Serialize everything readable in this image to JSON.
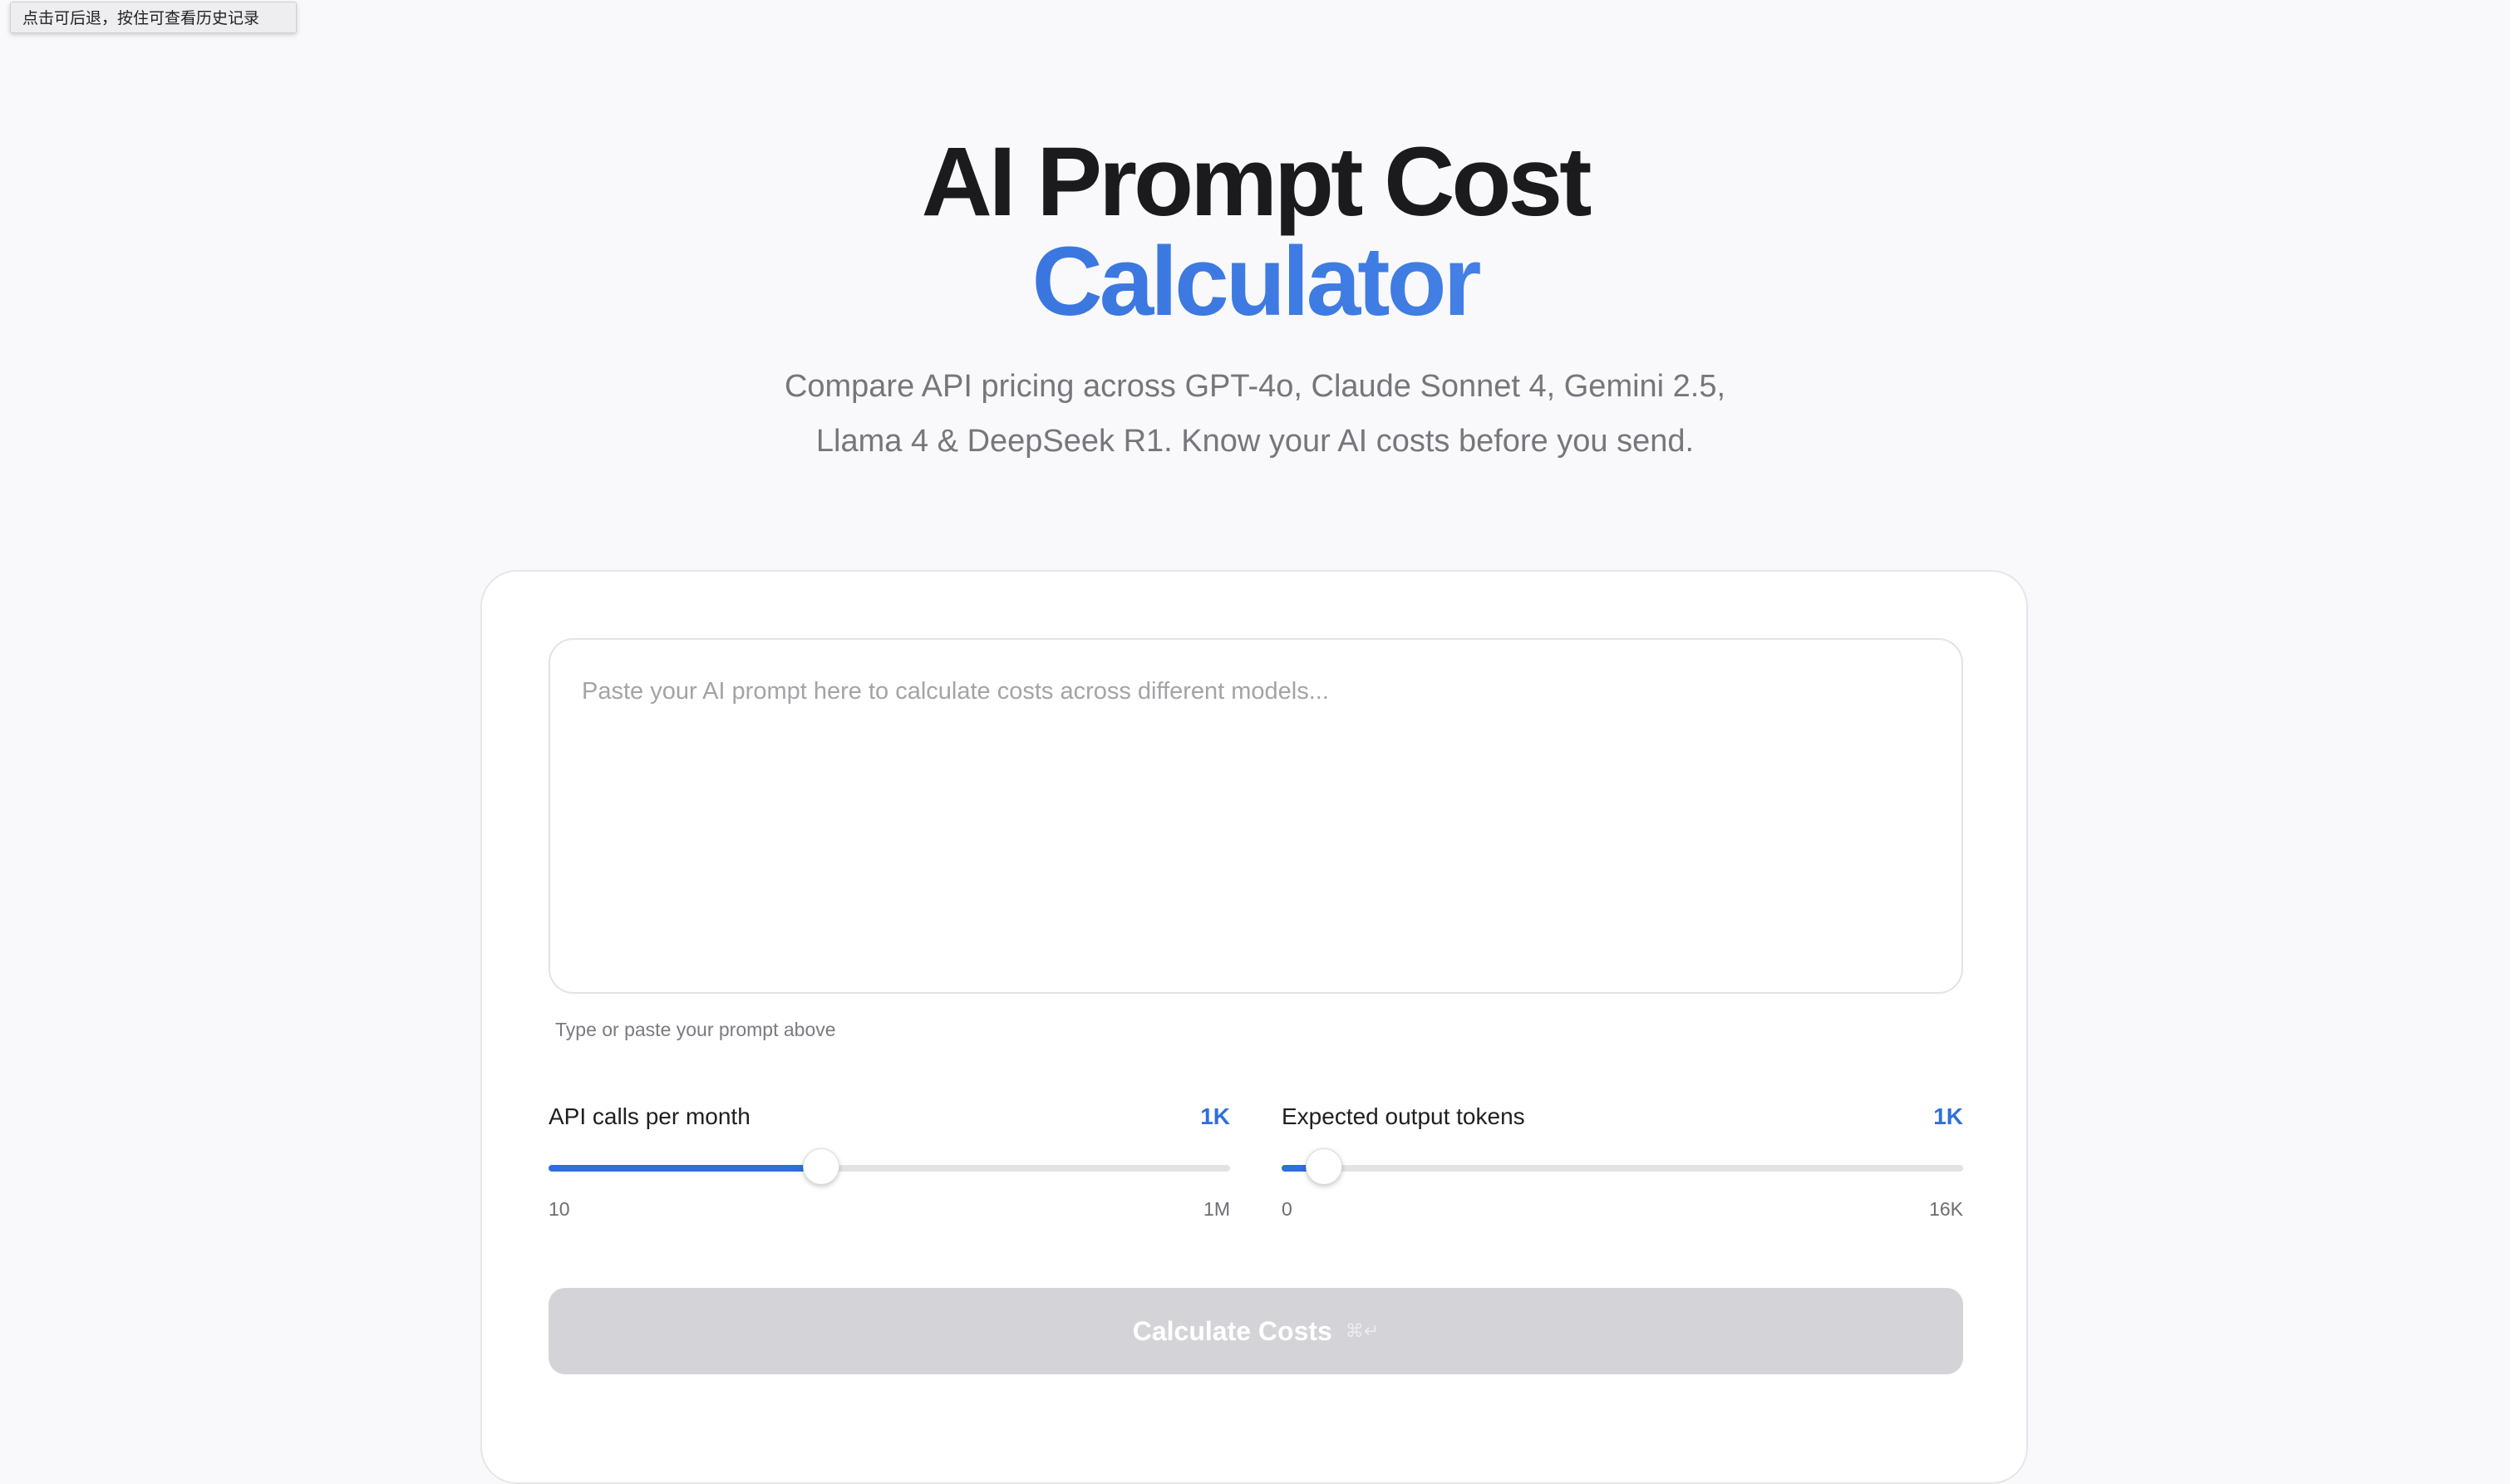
{
  "tooltip": {
    "text": "点击可后退，按住可查看历史记录"
  },
  "hero": {
    "title_line1": "AI Prompt Cost",
    "title_line2": "Calculator",
    "subtitle": "Compare API pricing across GPT-4o, Claude Sonnet 4, Gemini 2.5, Llama 4 & DeepSeek R1. Know your AI costs before you send."
  },
  "prompt": {
    "value": "",
    "placeholder": "Paste your AI prompt here to calculate costs across different models...",
    "hint": "Type or paste your prompt above"
  },
  "sliders": {
    "api_calls": {
      "label": "API calls per month",
      "value_label": "1K",
      "min_label": "10",
      "max_label": "1M",
      "position_fraction": 0.4
    },
    "output_tokens": {
      "label": "Expected output tokens",
      "value_label": "1K",
      "min_label": "0",
      "max_label": "16K",
      "position_fraction": 0.0625
    }
  },
  "button": {
    "label": "Calculate Costs",
    "shortcut": "⌘↵",
    "enabled": false
  },
  "colors": {
    "accent": "#2f6fdc",
    "button_disabled": "#d4d4d8"
  }
}
